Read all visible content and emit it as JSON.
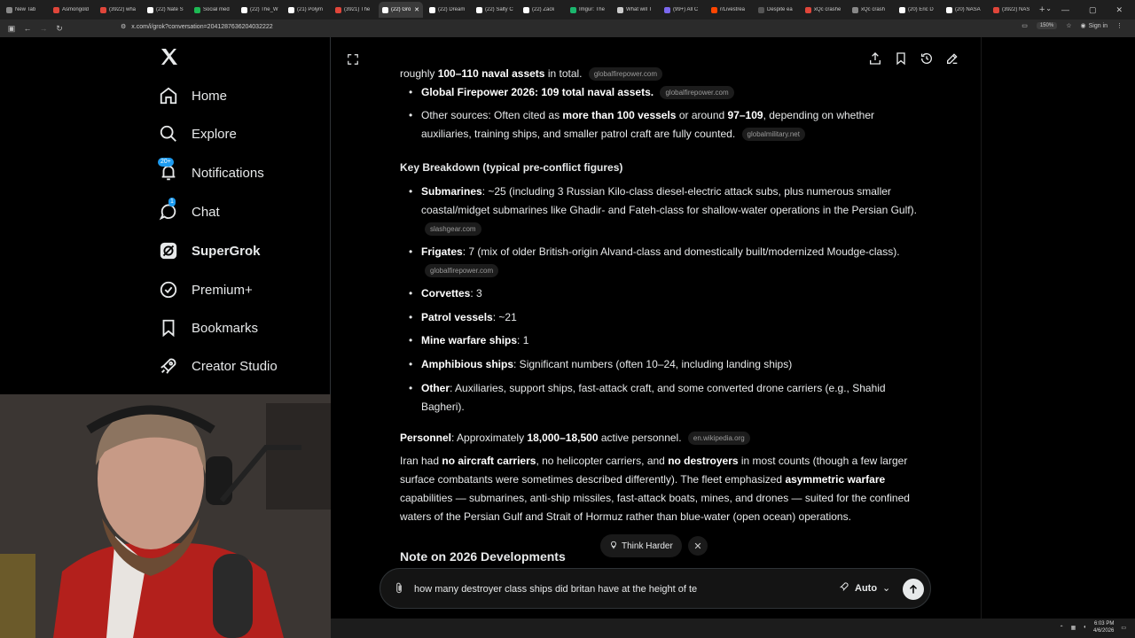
{
  "browser": {
    "tabs": [
      {
        "label": "New Tab",
        "color": "#888888"
      },
      {
        "label": "Asmongold",
        "color": "#e0463a"
      },
      {
        "label": "(3922) wha",
        "color": "#e0463a"
      },
      {
        "label": "(22) Nate S",
        "color": "#ffffff"
      },
      {
        "label": "Social med",
        "color": "#1db954"
      },
      {
        "label": "(22) The_W",
        "color": "#ffffff"
      },
      {
        "label": "(21) Polym",
        "color": "#ffffff"
      },
      {
        "label": "(3921) The",
        "color": "#e0463a"
      },
      {
        "label": "(22) Gro",
        "color": "#ffffff",
        "active": true
      },
      {
        "label": "(22) Dream",
        "color": "#ffffff"
      },
      {
        "label": "(22) Salty C",
        "color": "#ffffff"
      },
      {
        "label": "(22) Zack",
        "color": "#ffffff"
      },
      {
        "label": "Imgur: The",
        "color": "#1bb76e"
      },
      {
        "label": "What will T",
        "color": "#cccccc"
      },
      {
        "label": "(99+) All C",
        "color": "#7b68ee"
      },
      {
        "label": "r/Livestrea",
        "color": "#ff4500"
      },
      {
        "label": "Despite ea",
        "color": "#555555"
      },
      {
        "label": "xQc crashe",
        "color": "#e0463a"
      },
      {
        "label": "xQc crash",
        "color": "#888888"
      },
      {
        "label": "(20) Eric D",
        "color": "#ffffff"
      },
      {
        "label": "(20) NASA",
        "color": "#ffffff"
      },
      {
        "label": "(3922) NAS",
        "color": "#e0463a"
      }
    ],
    "url": "x.com/i/grok?conversation=2041287636204032222",
    "zoom": "150%",
    "signin": "Sign in"
  },
  "nav": {
    "items": [
      {
        "id": "home",
        "label": "Home",
        "icon": "home-icon"
      },
      {
        "id": "explore",
        "label": "Explore",
        "icon": "search-icon"
      },
      {
        "id": "notifications",
        "label": "Notifications",
        "icon": "bell-icon",
        "badge": "20+"
      },
      {
        "id": "chat",
        "label": "Chat",
        "icon": "chat-icon",
        "badge": "1"
      },
      {
        "id": "supergrok",
        "label": "SuperGrok",
        "icon": "grok-icon",
        "bold": true
      },
      {
        "id": "premium",
        "label": "Premium+",
        "icon": "verified-icon"
      },
      {
        "id": "bookmarks",
        "label": "Bookmarks",
        "icon": "bookmark-icon"
      },
      {
        "id": "creator",
        "label": "Creator Studio",
        "icon": "rocket-icon"
      }
    ]
  },
  "content": {
    "line0_a": "roughly ",
    "line0_b": "100–110 naval assets",
    "line0_c": " in total.",
    "line0_src": "globalfirepower.com",
    "b1_bold": "Global Firepower 2026: 109 total naval assets.",
    "b1_src": "globalfirepower.com",
    "b2_a": "Other sources: Often cited as ",
    "b2_b": "more than 100 vessels",
    "b2_c": " or around ",
    "b2_d": "97–109",
    "b2_e": ", depending on whether auxiliaries, training ships, and smaller patrol craft are fully counted.",
    "b2_src": "globalmilitary.net",
    "heading1": "Key Breakdown (typical pre-conflict figures)",
    "subs_label": "Submarines",
    "subs_text": ": ~25 (including 3 Russian Kilo-class diesel-electric attack subs, plus numerous smaller coastal/midget submarines like Ghadir- and Fateh-class for shallow-water operations in the Persian Gulf).",
    "subs_src": "slashgear.com",
    "frig_label": "Frigates",
    "frig_text": ": 7 (mix of older British-origin Alvand-class and domestically built/modernized Moudge-class).",
    "frig_src": "globalfirepower.com",
    "corv_label": "Corvettes",
    "corv_text": ": 3",
    "patrol_label": "Patrol vessels",
    "patrol_text": ": ~21",
    "mine_label": "Mine warfare ships",
    "mine_text": ": 1",
    "amph_label": "Amphibious ships",
    "amph_text": ": Significant numbers (often 10–24, including landing ships)",
    "other_label": "Other",
    "other_text": ": Auxiliaries, support ships, fast-attack craft, and some converted drone carriers (e.g., Shahid Bagheri).",
    "pers_label": "Personnel",
    "pers_text_a": ": Approximately ",
    "pers_text_b": "18,000–18,500",
    "pers_text_c": " active personnel.",
    "pers_src": "en.wikipedia.org",
    "p_a": "Iran had ",
    "p_b": "no aircraft carriers",
    "p_c": ", no helicopter carriers, and ",
    "p_d": "no destroyers",
    "p_e": " in most counts (though a few larger surface combatants were sometimes described differently). The fleet emphasized ",
    "p_f": "asymmetric warfare",
    "p_g": " capabilities — submarines, anti-ship missiles, fast-attack boats, mines, and drones — suited for the confined waters of the Persian Gulf and Strait of Hormuz rather than blue-water (open ocean) operations.",
    "heading2": "Note on 2026 Developments"
  },
  "composer": {
    "think_label": "Think Harder",
    "input_value": "how many destroyer class ships did britan have at the height of te",
    "mode_label": "Auto"
  },
  "taskbar": {
    "time": "6:03 PM",
    "date": "4/6/2026"
  },
  "colors": {
    "accent": "#1d9bf0",
    "background": "#000000"
  }
}
